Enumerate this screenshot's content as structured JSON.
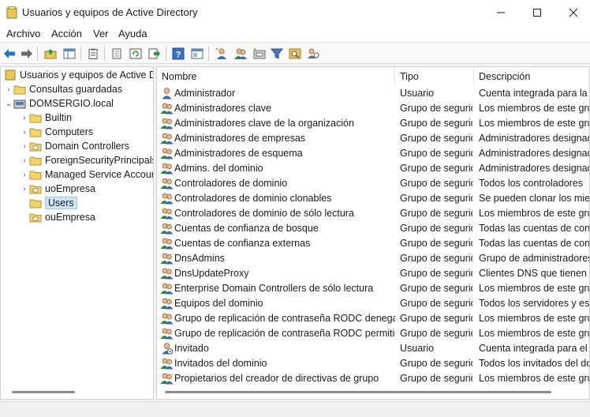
{
  "window": {
    "title": "Usuarios y equipos de Active Directory"
  },
  "menu": [
    "Archivo",
    "Acción",
    "Ver",
    "Ayuda"
  ],
  "toolbar": {
    "buttons": [
      "back-icon",
      "forward-icon",
      "up-folder-icon",
      "show-tree-icon",
      "properties-icon",
      "export-icon",
      "refresh-icon",
      "export-list-icon",
      "help-icon",
      "view-icon",
      "new-user-icon",
      "new-group-icon",
      "new-ou-icon",
      "filter-icon",
      "find-icon",
      "add-to-group-icon"
    ]
  },
  "tree": {
    "root": "Usuarios y equipos de Active Directory",
    "saved_queries": "Consultas guardadas",
    "domain": "DOMSERGIO.local",
    "children": [
      "Builtin",
      "Computers",
      "Domain Controllers",
      "ForeignSecurityPrincipals",
      "Managed Service Accounts",
      "uoEmpresa",
      "Users",
      "ouEmpresa"
    ]
  },
  "columns": {
    "name": "Nombre",
    "type": "Tipo",
    "description": "Descripción"
  },
  "rows": [
    {
      "name": "Administrador",
      "type": "Usuario",
      "desc": "Cuenta integrada para la administración",
      "icon": "user-icon"
    },
    {
      "name": "Administradores clave",
      "type": "Grupo de seguridad",
      "desc": "Los miembros de este grupo",
      "icon": "group-icon"
    },
    {
      "name": "Administradores clave de la organización",
      "type": "Grupo de seguridad",
      "desc": "Los miembros de este grupo",
      "icon": "group-icon"
    },
    {
      "name": "Administradores de empresas",
      "type": "Grupo de seguridad",
      "desc": "Administradores designados",
      "icon": "group-icon"
    },
    {
      "name": "Administradores de esquema",
      "type": "Grupo de seguridad",
      "desc": "Administradores designados",
      "icon": "group-icon"
    },
    {
      "name": "Admins. del dominio",
      "type": "Grupo de seguridad",
      "desc": "Administradores designados",
      "icon": "group-icon"
    },
    {
      "name": "Controladores de dominio",
      "type": "Grupo de seguridad",
      "desc": "Todos los controladores",
      "icon": "group-icon"
    },
    {
      "name": "Controladores de dominio clonables",
      "type": "Grupo de seguridad",
      "desc": "Se pueden clonar los miembros",
      "icon": "group-icon"
    },
    {
      "name": "Controladores de dominio de sólo lectura",
      "type": "Grupo de seguridad",
      "desc": "Los miembros de este grupo",
      "icon": "group-icon"
    },
    {
      "name": "Cuentas de confianza de bosque",
      "type": "Grupo de seguridad",
      "desc": "Todas las cuentas de confianza",
      "icon": "group-icon"
    },
    {
      "name": "Cuentas de confianza externas",
      "type": "Grupo de seguridad",
      "desc": "Todas las cuentas de confianza",
      "icon": "group-icon"
    },
    {
      "name": "DnsAdmins",
      "type": "Grupo de seguridad",
      "desc": "Grupo de administradores",
      "icon": "group-icon"
    },
    {
      "name": "DnsUpdateProxy",
      "type": "Grupo de seguridad",
      "desc": "Clientes DNS que tienen",
      "icon": "group-icon"
    },
    {
      "name": "Enterprise Domain Controllers de sólo lectura",
      "type": "Grupo de seguridad",
      "desc": "Los miembros de este grupo",
      "icon": "group-icon"
    },
    {
      "name": "Equipos del dominio",
      "type": "Grupo de seguridad",
      "desc": "Todos los servidores y estaciones",
      "icon": "group-icon"
    },
    {
      "name": "Grupo de replicación de contraseña RODC denegada",
      "type": "Grupo de seguridad",
      "desc": "Los miembros de este grupo",
      "icon": "group-icon"
    },
    {
      "name": "Grupo de replicación de contraseña RODC permitida",
      "type": "Grupo de seguridad",
      "desc": "Los miembros de este grupo",
      "icon": "group-icon"
    },
    {
      "name": "Invitado",
      "type": "Usuario",
      "desc": "Cuenta integrada para el acceso",
      "icon": "disabled-user-icon"
    },
    {
      "name": "Invitados del dominio",
      "type": "Grupo de seguridad",
      "desc": "Todos los invitados del dominio",
      "icon": "group-icon"
    },
    {
      "name": "Propietarios del creador de directivas de grupo",
      "type": "Grupo de seguridad",
      "desc": "Los miembros de este grupo",
      "icon": "group-icon"
    }
  ]
}
